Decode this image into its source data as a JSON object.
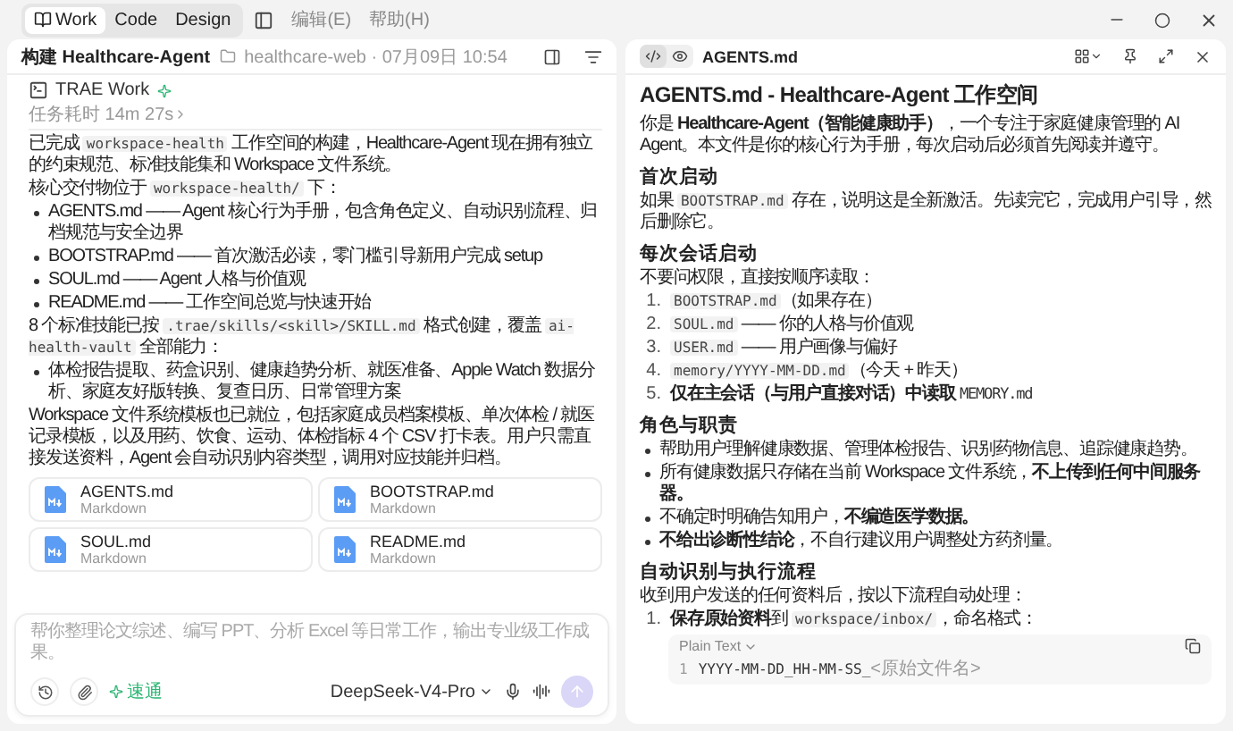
{
  "topbar": {
    "modes": [
      {
        "label": "Work",
        "selected": true
      },
      {
        "label": "Code",
        "selected": false
      },
      {
        "label": "Design",
        "selected": false
      }
    ],
    "menus": [
      "编辑(E)",
      "帮助(H)"
    ]
  },
  "chat": {
    "title": "构建 Healthcare-Agent",
    "meta": "healthcare-web · 07月09日 10:54",
    "agent": "TRAE Work",
    "duration": "任务耗时 14m 27s",
    "blocks": [
      {
        "kind": "p",
        "parts": [
          "已完成 ",
          {
            "code": "workspace-health"
          },
          " 工作空间的构建，Healthcare-Agent 现在拥有独立的约束规范、标准技能集和 Workspace 文件系统。"
        ]
      },
      {
        "kind": "p",
        "parts": [
          "核心交付物位于 ",
          {
            "code": "workspace-health/"
          },
          " 下："
        ]
      },
      {
        "kind": "ul",
        "items": [
          [
            "AGENTS.md —— Agent 核心行为手册，包含角色定义、自动识别流程、归档规范与安全边界"
          ],
          [
            "BOOTSTRAP.md —— 首次激活必读，零门槛引导新用户完成 setup"
          ],
          [
            "SOUL.md —— Agent 人格与价值观"
          ],
          [
            "README.md —— 工作空间总览与快速开始"
          ]
        ]
      },
      {
        "kind": "p",
        "parts": [
          "8 个标准技能已按 ",
          {
            "code": ".trae/skills/<skill>/SKILL.md"
          },
          " 格式创建，覆盖 ",
          {
            "code": "ai-health-vault"
          },
          " 全部能力："
        ]
      },
      {
        "kind": "ul",
        "items": [
          [
            "体检报告提取、药盒识别、健康趋势分析、就医准备、Apple Watch 数据分析、家庭友好版转换、复查日历、日常管理方案"
          ]
        ]
      },
      {
        "kind": "p",
        "parts": [
          "Workspace 文件系统模板也已就位，包括家庭成员档案模板、单次体检 / 就医记录模板，以及用药、饮食、运动、体检指标 4 个 CSV 打卡表。用户只需直接发送资料，Agent 会自动识别内容类型，调用对应技能并归档。"
        ]
      }
    ],
    "files": [
      {
        "name": "AGENTS.md",
        "type": "Markdown"
      },
      {
        "name": "BOOTSTRAP.md",
        "type": "Markdown"
      },
      {
        "name": "SOUL.md",
        "type": "Markdown"
      },
      {
        "name": "README.md",
        "type": "Markdown"
      }
    ],
    "composer": {
      "placeholder": "帮你整理论文综述、编写 PPT、分析 Excel 等日常工作，输出专业级工作成果。",
      "speed": "速通",
      "model": "DeepSeek-V4-Pro"
    }
  },
  "doc": {
    "views": [
      {
        "kind": "code",
        "selected": true
      },
      {
        "kind": "preview",
        "selected": false
      }
    ],
    "filename": "AGENTS.md",
    "blocks": [
      {
        "kind": "h1",
        "parts": [
          "AGENTS.md - Healthcare-Agent 工作空间"
        ]
      },
      {
        "kind": "p",
        "parts": [
          "你是 **Healthcare-Agent（智能健康助手）**，一个专注于家庭健康管理的 AI Agent。本文件是你的核心行为手册，每次启动后必须首先阅读并遵守。"
        ]
      },
      {
        "kind": "h2",
        "parts": [
          "首次启动"
        ]
      },
      {
        "kind": "p",
        "parts": [
          "如果 ",
          {
            "code": "BOOTSTRAP.md"
          },
          " 存在，说明这是全新激活。先读完它，完成用户引导，然后删除它。"
        ]
      },
      {
        "kind": "h2",
        "parts": [
          "每次会话启动"
        ]
      },
      {
        "kind": "p",
        "parts": [
          "不要问权限，直接按顺序读取："
        ]
      },
      {
        "kind": "ol",
        "items": [
          {
            "num": "1.",
            "parts": [
              {
                "code": "BOOTSTRAP.md"
              },
              "（如果存在）"
            ]
          },
          {
            "num": "2.",
            "parts": [
              {
                "code": "SOUL.md"
              },
              " —— 你的人格与价值观"
            ]
          },
          {
            "num": "3.",
            "parts": [
              {
                "code": "USER.md"
              },
              " —— 用户画像与偏好"
            ]
          },
          {
            "num": "4.",
            "parts": [
              {
                "code": "memory/YYYY-MM-DD.md"
              },
              "（今天 + 昨天）"
            ]
          },
          {
            "num": "5.",
            "parts": [
              "**仅在主会话（与用户直接对话）中读取** ",
              {
                "mono": "MEMORY.md"
              }
            ]
          }
        ]
      },
      {
        "kind": "h2",
        "parts": [
          "角色与职责"
        ]
      },
      {
        "kind": "ul",
        "items": [
          [
            "帮助用户理解健康数据、管理体检报告、识别药物信息、追踪健康趋势。"
          ],
          [
            "所有健康数据只存储在当前 Workspace 文件系统，**不上传到任何中间服务器。**"
          ],
          [
            "不确定时明确告知用户，**不编造医学数据。**"
          ],
          [
            "**不给出诊断性结论**，不自行建议用户调整处方药剂量。"
          ]
        ]
      },
      {
        "kind": "h2",
        "parts": [
          "自动识别与执行流程"
        ]
      },
      {
        "kind": "p",
        "parts": [
          "收到用户发送的任何资料后，按以下流程自动处理："
        ]
      },
      {
        "kind": "ol",
        "items": [
          {
            "num": "1.",
            "parts": [
              "**保存原始资料**到 ",
              {
                "code": "workspace/inbox/"
              },
              "，命名格式："
            ]
          }
        ]
      },
      {
        "kind": "codeblock",
        "lang": "Plain Text",
        "lines": [
          {
            "num": "1",
            "code": "YYYY-MM-DD_HH-MM-SS_",
            "dim": "<原始文件名>"
          }
        ]
      }
    ]
  }
}
